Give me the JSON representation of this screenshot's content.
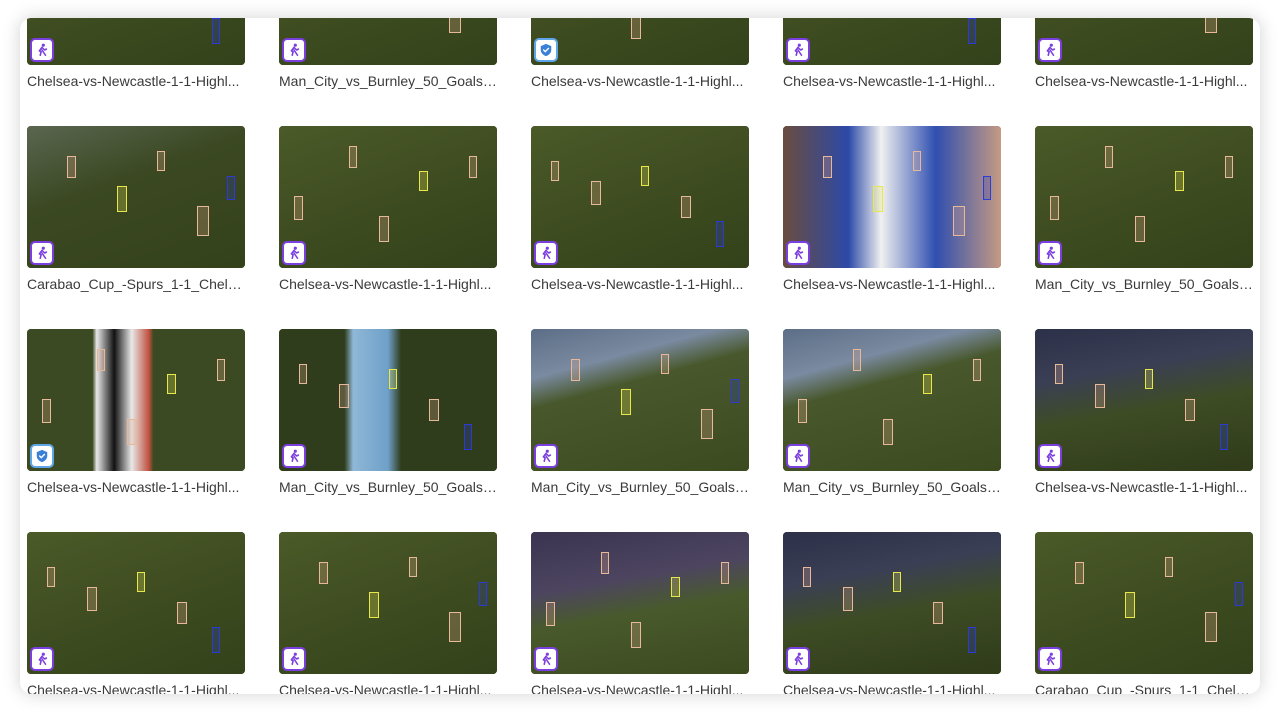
{
  "gallery": {
    "rows": [
      {
        "items": [
          {
            "name": "Chelsea-vs-Newcastle-1-1-Highl...",
            "badge": "runner-icon",
            "scene": "pitch"
          },
          {
            "name": "Man_City_vs_Burnley_50_Goals_...",
            "badge": "runner-icon",
            "scene": "pitch"
          },
          {
            "name": "Chelsea-vs-Newcastle-1-1-Highl...",
            "badge": "shield-icon",
            "scene": "pitch"
          },
          {
            "name": "Chelsea-vs-Newcastle-1-1-Highl...",
            "badge": "runner-icon",
            "scene": "pitch"
          },
          {
            "name": "Chelsea-vs-Newcastle-1-1-Highl...",
            "badge": "runner-icon",
            "scene": "pitch"
          }
        ]
      },
      {
        "items": [
          {
            "name": "Carabao_Cup_-Spurs_1-1_Chelse...",
            "badge": "runner-icon",
            "scene": "goal"
          },
          {
            "name": "Chelsea-vs-Newcastle-1-1-Highl...",
            "badge": "runner-icon",
            "scene": "pitch"
          },
          {
            "name": "Chelsea-vs-Newcastle-1-1-Highl...",
            "badge": "runner-icon",
            "scene": "pitch"
          },
          {
            "name": "Chelsea-vs-Newcastle-1-1-Highl...",
            "badge": "runner-icon",
            "scene": "closeup-blue"
          },
          {
            "name": "Man_City_vs_Burnley_50_Goals_...",
            "badge": "runner-icon",
            "scene": "pitch"
          }
        ]
      },
      {
        "items": [
          {
            "name": "Chelsea-vs-Newcastle-1-1-Highl...",
            "badge": "shield-icon",
            "scene": "closeup-stripes"
          },
          {
            "name": "Man_City_vs_Burnley_50_Goals_...",
            "badge": "runner-icon",
            "scene": "closeup-sky"
          },
          {
            "name": "Man_City_vs_Burnley_50_Goals_...",
            "badge": "runner-icon",
            "scene": "stands"
          },
          {
            "name": "Man_City_vs_Burnley_50_Goals_...",
            "badge": "runner-icon",
            "scene": "stands"
          },
          {
            "name": "Chelsea-vs-Newcastle-1-1-Highl...",
            "badge": "runner-icon",
            "scene": "night"
          }
        ]
      },
      {
        "items": [
          {
            "name": "Chelsea-vs-Newcastle-1-1-Highl...",
            "badge": "runner-icon",
            "scene": "pitch"
          },
          {
            "name": "Chelsea-vs-Newcastle-1-1-Highl...",
            "badge": "runner-icon",
            "scene": "pitch"
          },
          {
            "name": "Chelsea-vs-Newcastle-1-1-Highl...",
            "badge": "runner-icon",
            "scene": "crowd"
          },
          {
            "name": "Chelsea-vs-Newcastle-1-1-Highl...",
            "badge": "runner-icon",
            "scene": "night"
          },
          {
            "name": "Carabao_Cup_-Spurs_1-1_Chelse...",
            "badge": "runner-icon",
            "scene": "pitch"
          }
        ]
      }
    ]
  },
  "colors": {
    "badge_border": "#7b3fe0",
    "shield_border": "#5fa6e8",
    "box_default": "#e7b89a",
    "box_yellow": "#e8e84a",
    "box_blue": "#2a3bd6"
  }
}
